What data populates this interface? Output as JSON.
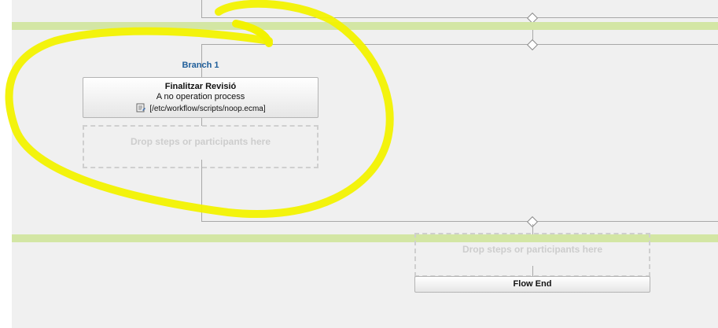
{
  "branch": {
    "title": "Branch 1",
    "step": {
      "title": "Finalitzar Revisió",
      "description": "A no operation process",
      "script": "[/etc/workflow/scripts/noop.ecma]",
      "icon": "script-icon"
    },
    "drop_label": "Drop steps or participants here"
  },
  "main": {
    "drop_label": "Drop steps or participants here",
    "flow_end_label": "Flow End"
  },
  "colors": {
    "highlight": "#f2f200",
    "band": "#d3e6a4",
    "branch_title": "#1f5e9a"
  }
}
